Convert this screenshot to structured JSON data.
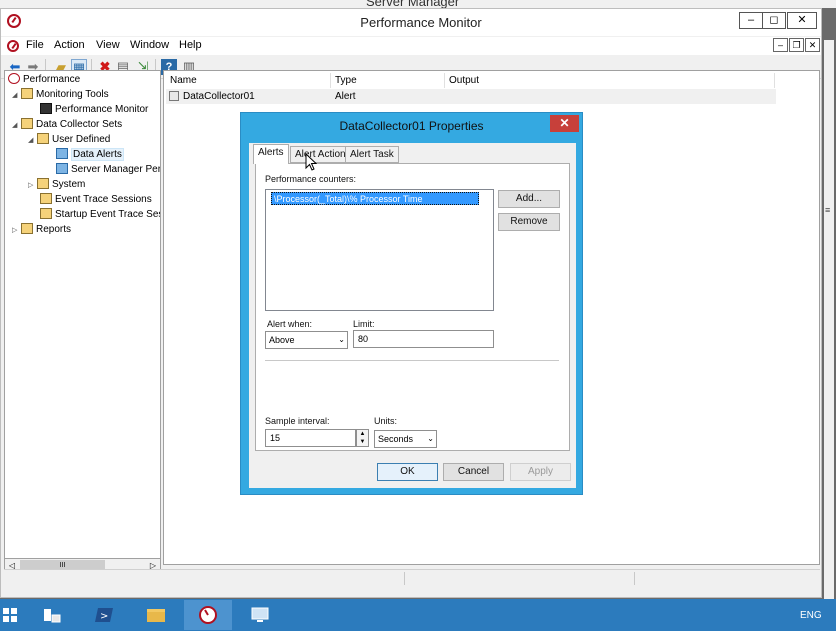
{
  "background_window": {
    "title": "Server Manager"
  },
  "window": {
    "title": "Performance Monitor",
    "controls": {
      "minimize": "–",
      "restore": "◻",
      "close": "✕"
    }
  },
  "menu": [
    "File",
    "Action",
    "View",
    "Window",
    "Help"
  ],
  "toolbar_icons": [
    "back-icon",
    "forward-icon",
    "up-folder-icon",
    "show-hide-tree-icon",
    "delete-icon",
    "properties-icon",
    "export-icon",
    "help-icon",
    "view-icon"
  ],
  "tree": {
    "items": [
      {
        "label": "Performance"
      },
      {
        "label": "Monitoring Tools"
      },
      {
        "label": "Performance Monitor"
      },
      {
        "label": "Data Collector Sets"
      },
      {
        "label": "User Defined"
      },
      {
        "label": "Data Alerts"
      },
      {
        "label": "Server Manager Performance Monitor"
      },
      {
        "label": "System"
      },
      {
        "label": "Event Trace Sessions"
      },
      {
        "label": "Startup Event Trace Sessions"
      },
      {
        "label": "Reports"
      }
    ]
  },
  "list": {
    "columns": [
      "Name",
      "Type",
      "Output"
    ],
    "rows": [
      {
        "name": "DataCollector01",
        "type": "Alert",
        "output": ""
      }
    ]
  },
  "dialog": {
    "title": "DataCollector01 Properties",
    "close": "✕",
    "tabs": [
      "Alerts",
      "Alert Action",
      "Alert Task"
    ],
    "active_tab": "Alerts",
    "performance_counters_label": "Performance counters:",
    "counters": [
      "\\Processor(_Total)\\% Processor Time"
    ],
    "add_button": "Add...",
    "remove_button": "Remove",
    "alert_when_label": "Alert when:",
    "alert_when_value": "Above",
    "limit_label": "Limit:",
    "limit_value": "80",
    "sample_interval_label": "Sample interval:",
    "sample_interval_value": "15",
    "units_label": "Units:",
    "units_value": "Seconds",
    "ok_button": "OK",
    "cancel_button": "Cancel",
    "apply_button": "Apply"
  },
  "taskbar": {
    "language": "ENG"
  },
  "colors": {
    "accent": "#0a74c8",
    "dialog_frame": "#34a9e1",
    "close_red": "#c7403a",
    "taskbar": "#2c7bbd",
    "selection": "#3399ff"
  }
}
